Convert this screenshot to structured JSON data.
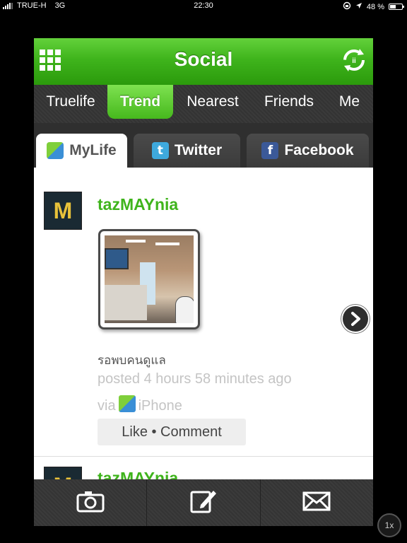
{
  "status_bar": {
    "carrier": "TRUE-H",
    "network": "3G",
    "time": "22:30",
    "battery": "48 %",
    "battery_level": 0.48
  },
  "header": {
    "title": "Social",
    "menu_icon": "grid-icon",
    "refresh_icon": "refresh-icon"
  },
  "nav_tabs": [
    {
      "label": "Truelife",
      "active": false
    },
    {
      "label": "Trend",
      "active": true
    },
    {
      "label": "Nearest",
      "active": false
    },
    {
      "label": "Friends",
      "active": false
    },
    {
      "label": "Me",
      "active": false
    }
  ],
  "sub_tabs": [
    {
      "label": "MyLife",
      "icon": "mylife-icon",
      "active": true
    },
    {
      "label": "Twitter",
      "icon": "twitter-icon",
      "active": false
    },
    {
      "label": "Facebook",
      "icon": "facebook-icon",
      "active": false
    }
  ],
  "posts": [
    {
      "username": "tazMAYnia",
      "caption": "รอพบคนดูแล",
      "posted": "posted 4 hours 58 minutes ago",
      "via_prefix": "via",
      "via_source": "iPhone",
      "action_label": "Like • Comment"
    },
    {
      "username": "tazMAYnia"
    }
  ],
  "bottom_bar": {
    "items": [
      "camera-icon",
      "compose-icon",
      "mail-icon"
    ]
  },
  "zoom_label": "1x",
  "colors": {
    "accent_green": "#3fb41c",
    "toolbar_dark": "#333333"
  }
}
